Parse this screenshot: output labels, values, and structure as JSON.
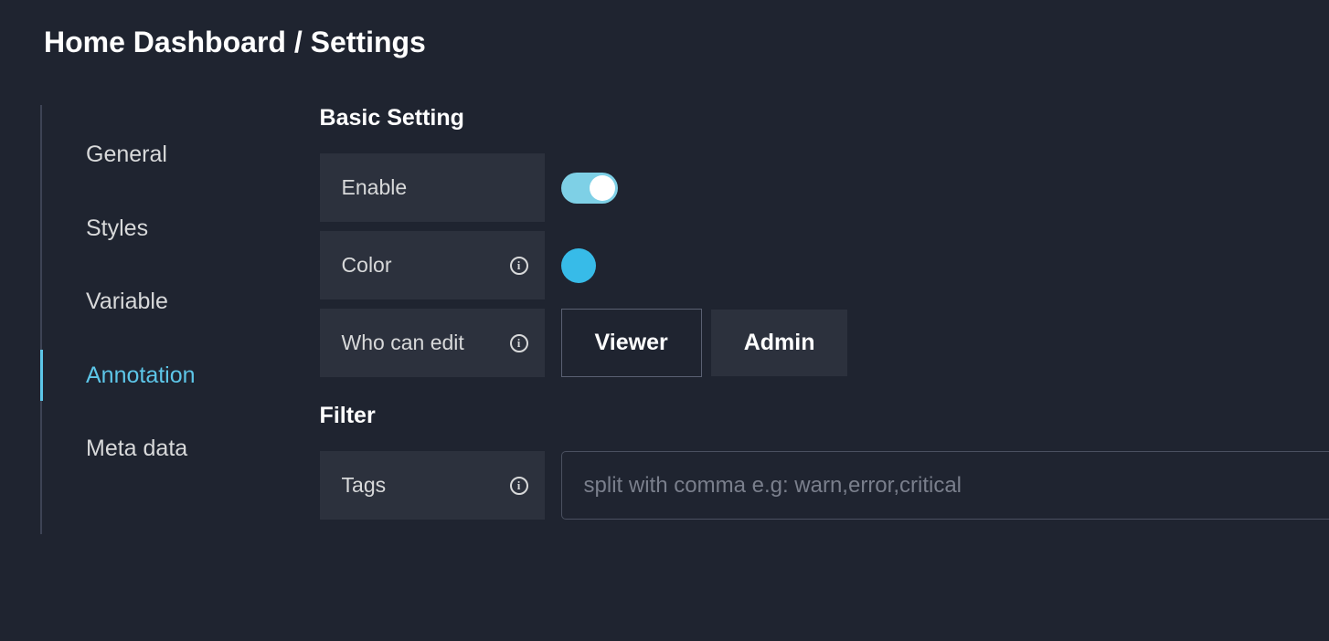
{
  "breadcrumb": "Home Dashboard / Settings",
  "sidebar": {
    "items": [
      "General",
      "Styles",
      "Variable",
      "Annotation",
      "Meta data"
    ],
    "active_index": 3
  },
  "basic_setting": {
    "title": "Basic Setting",
    "enable": {
      "label": "Enable",
      "value": true
    },
    "color": {
      "label": "Color",
      "value": "#37bbe8"
    },
    "who_can_edit": {
      "label": "Who can edit",
      "options": [
        "Viewer",
        "Admin"
      ],
      "selected_index": 0
    }
  },
  "filter": {
    "title": "Filter",
    "tags": {
      "label": "Tags",
      "value": "",
      "placeholder": "split with comma e.g: warn,error,critical"
    }
  }
}
